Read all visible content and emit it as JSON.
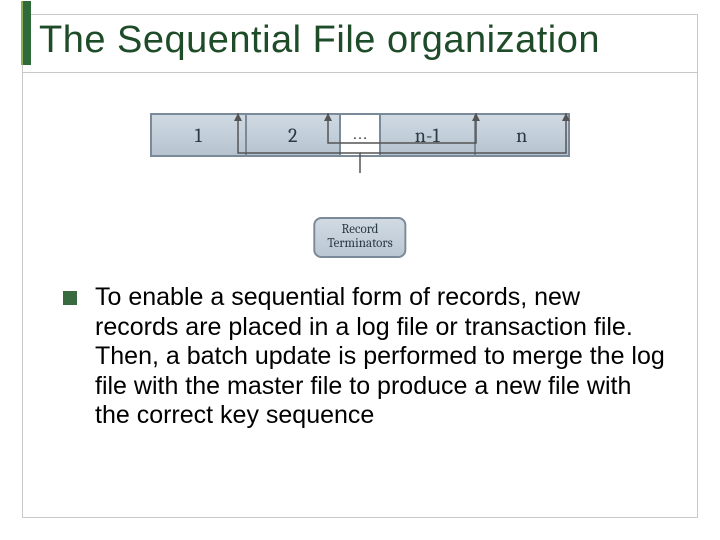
{
  "title": "The Sequential File organization",
  "diagram": {
    "blocks": [
      "1",
      "2",
      "n-1",
      "n"
    ],
    "ellipsis": "…",
    "label": "Record\nTerminators"
  },
  "bullet": {
    "text": "To enable a sequential form of records, new records are placed in a log file or transaction file. Then, a batch update is performed to merge the log file with the master file to produce a new file with the correct key sequence"
  }
}
